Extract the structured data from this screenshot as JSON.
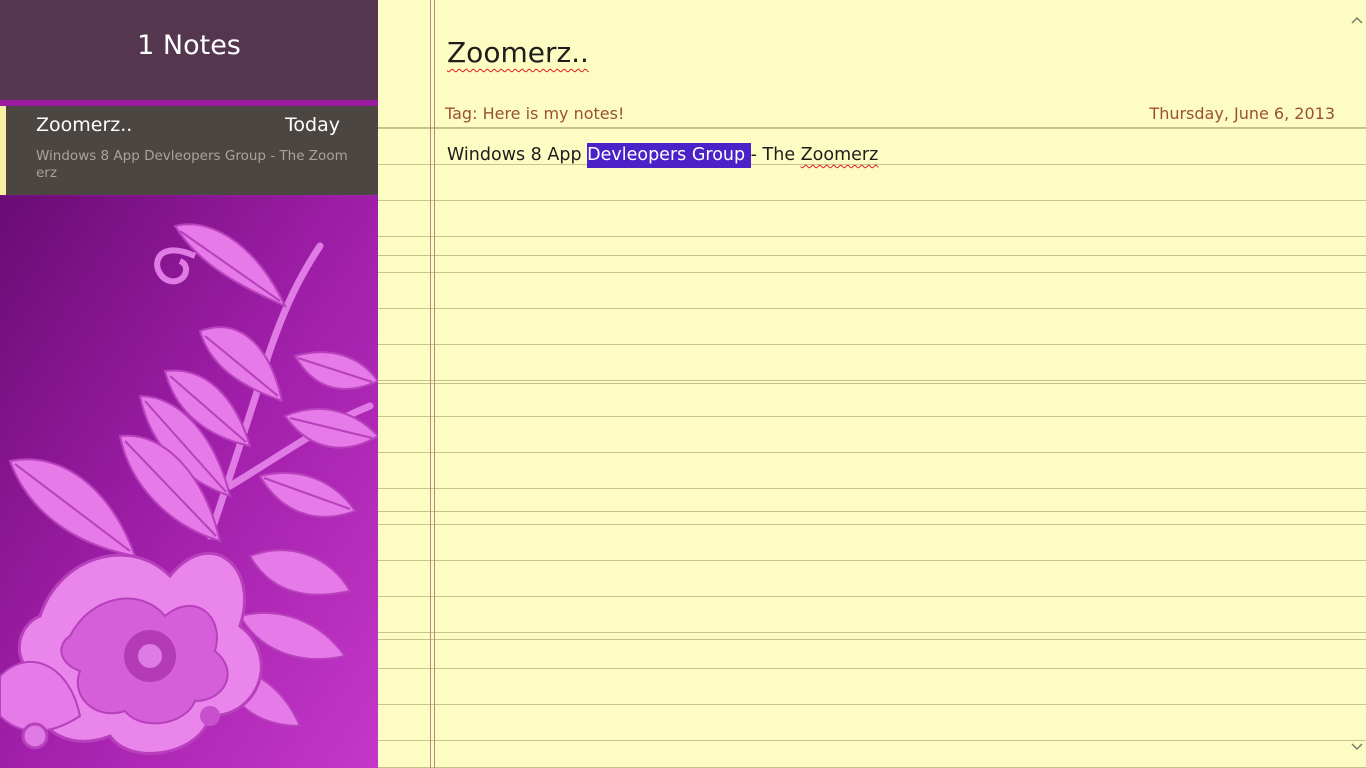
{
  "sidebar": {
    "title": "1 Notes",
    "notes": [
      {
        "title": "Zoomerz..",
        "date": "Today",
        "preview": "Windows 8 App Devleopers Group - The Zoomerz"
      }
    ]
  },
  "note": {
    "title": "Zoomerz..",
    "tag": "Tag: Here is my notes!",
    "date": "Thursday, June 6, 2013",
    "body_pre": "Windows 8 App ",
    "body_selected": "Devleopers Group ",
    "body_mid": "- The ",
    "body_last": "Zoomerz"
  },
  "icons": {
    "scroll_up": "chevron-up-icon",
    "scroll_down": "chevron-down-icon",
    "background_art": "floral-pattern"
  },
  "colors": {
    "sidebar_header": "#55364f",
    "sidebar_accent": "#9a1aa0",
    "note_item_bg": "#4b4642",
    "note_item_accent": "#f6f0a0",
    "paper": "#fdfcc2",
    "rule_line": "#c4c08a",
    "margin_line": "#b98a7e",
    "meta_text": "#9b5036",
    "selection": "#4a22c8"
  }
}
